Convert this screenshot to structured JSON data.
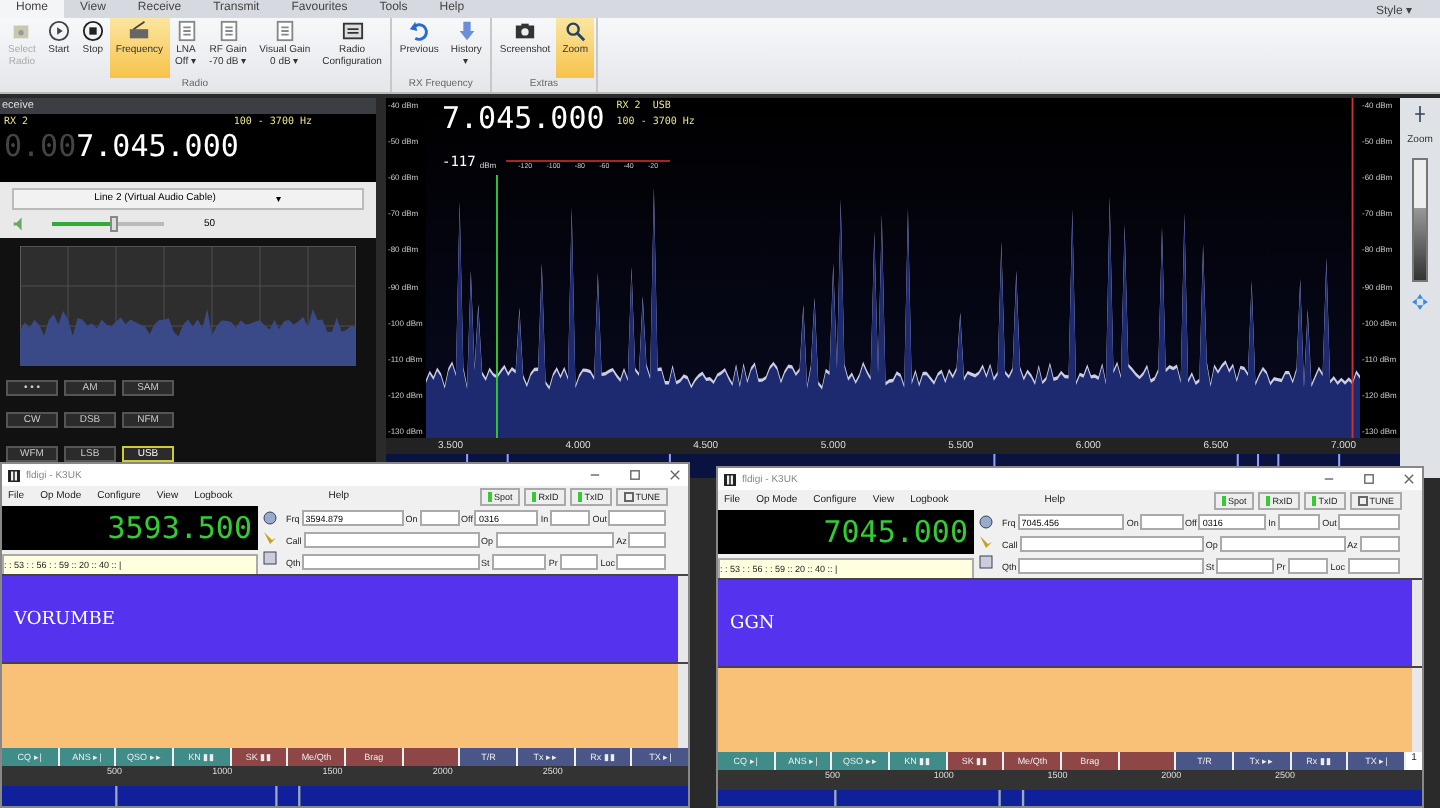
{
  "menu_tabs": [
    {
      "label": "Home",
      "selected": true
    },
    {
      "label": "View",
      "selected": false
    },
    {
      "label": "Receive",
      "selected": false
    },
    {
      "label": "Transmit",
      "selected": false
    },
    {
      "label": "Favourites",
      "selected": false
    },
    {
      "label": "Tools",
      "selected": false
    },
    {
      "label": "Help",
      "selected": false
    }
  ],
  "style_menu": "Style ▾",
  "ribbon_groups": [
    {
      "label": "Radio",
      "buttons": [
        {
          "kind": "select",
          "label": "Select",
          "sub": "Radio",
          "disabled": true,
          "selected": false
        },
        {
          "kind": "start",
          "label": "Start",
          "disabled": false,
          "selected": false
        },
        {
          "kind": "stop",
          "label": "Stop",
          "disabled": false,
          "selected": false
        },
        {
          "kind": "freq",
          "label": "Frequency",
          "disabled": false,
          "selected": true
        },
        {
          "kind": "list",
          "label": "LNA",
          "sub": "Off ▾",
          "disabled": false,
          "selected": false
        },
        {
          "kind": "list",
          "label": "RF Gain",
          "sub": "-70 dB ▾",
          "disabled": false,
          "selected": false
        },
        {
          "kind": "list",
          "label": "Visual Gain",
          "sub": "0 dB ▾",
          "disabled": false,
          "selected": false
        },
        {
          "kind": "config",
          "label": "Radio",
          "sub": "Configuration",
          "disabled": false,
          "selected": false
        }
      ]
    },
    {
      "label": "RX Frequency",
      "buttons": [
        {
          "kind": "undo",
          "label": "Previous",
          "disabled": false,
          "selected": false
        },
        {
          "kind": "history",
          "label": "History",
          "sub": "▾",
          "disabled": false,
          "selected": false
        }
      ]
    },
    {
      "label": "Extras",
      "buttons": [
        {
          "kind": "camera",
          "label": "Screenshot",
          "disabled": false,
          "selected": false
        },
        {
          "kind": "zoom",
          "label": "Zoom",
          "disabled": false,
          "selected": true
        }
      ]
    }
  ],
  "receive_panel": {
    "title": "eceive",
    "rx": "RX 2",
    "band": "100 - 3700 Hz",
    "freq_dim": "0.00",
    "freq": "7.045.000",
    "device": "Line 2 (Virtual Audio Cable)",
    "device_caret": "▾",
    "volume": {
      "level": 0.55,
      "reading": "50"
    },
    "modes": [
      {
        "label": "• • •",
        "selected": false
      },
      {
        "label": "AM",
        "selected": false
      },
      {
        "label": "SAM",
        "selected": false
      },
      {
        "label": "CW",
        "selected": false
      },
      {
        "label": "DSB",
        "selected": false
      },
      {
        "label": "NFM",
        "selected": false
      },
      {
        "label": "WFM",
        "selected": false
      },
      {
        "label": "LSB",
        "selected": false
      },
      {
        "label": "USB",
        "selected": true
      }
    ]
  },
  "spectrum": {
    "freq": "7.045.000",
    "rx": "RX 2",
    "mode": "USB",
    "band": "100 - 3700 Hz",
    "signal": "-117",
    "unit": "dBm",
    "meter_scale": [
      "-120",
      "-100",
      "-80",
      "-60",
      "-40",
      "-20"
    ],
    "y_labels": [
      "-40 dBm",
      "-50 dBm",
      "-60 dBm",
      "-70 dBm",
      "-80 dBm",
      "-90 dBm",
      "-100 dBm",
      "-110 dBm",
      "-120 dBm",
      "-130 dBm"
    ],
    "y_labels_right": [
      "-40 dBm",
      "-50 dBm",
      "-60 dBm",
      "-70 dBm",
      "-80 dBm",
      "-90 dBm",
      "-100 dBm",
      "-110 dBm",
      "-120 dBm",
      "-130 dBm"
    ],
    "x_labels": [
      "3.500",
      "4.000",
      "4.500",
      "5.000",
      "5.500",
      "6.000",
      "6.500",
      "7.000"
    ]
  },
  "side_strip": {
    "label": "Zoom",
    "level": 0.6
  },
  "fldigi_windows": [
    {
      "title": "fldigi - K3UK",
      "menu": [
        "File",
        "Op Mode",
        "Configure",
        "View",
        "Logbook",
        "Help"
      ],
      "indicators": [
        {
          "label": "Spot",
          "kind": "led",
          "on": true
        },
        {
          "label": "RxID",
          "kind": "led",
          "on": true
        },
        {
          "label": "TxID",
          "kind": "led",
          "on": true
        },
        {
          "label": "TUNE",
          "kind": "check",
          "checked": false
        }
      ],
      "freq": "3593.500",
      "time_strip": ": : 53 : : 56 : : 59 :: 20 :: 40 :: |",
      "fields": [
        {
          "label": "Frq",
          "value": "3594.879"
        },
        {
          "label": "On"
        },
        {
          "label": "Off",
          "value": "0316"
        },
        {
          "label": "In"
        },
        {
          "label": "Out"
        },
        {
          "label": "Call"
        },
        {
          "label": "Op"
        },
        {
          "label": "Az"
        },
        {
          "label": "Qth"
        },
        {
          "label": "St"
        },
        {
          "label": "Pr"
        },
        {
          "label": "Loc"
        }
      ],
      "rx_text": "VORUMBE",
      "macros": [
        {
          "label": "CQ ▸|",
          "color": "#3f8c88"
        },
        {
          "label": "ANS ▸|",
          "color": "#3f8c88"
        },
        {
          "label": "QSO ▸▸",
          "color": "#3f8c88"
        },
        {
          "label": "KN ▮▮",
          "color": "#3f8c88"
        },
        {
          "label": "SK ▮▮",
          "color": "#8e4646"
        },
        {
          "label": "Me/Qth",
          "color": "#8e4646"
        },
        {
          "label": "Brag",
          "color": "#8e4646"
        },
        {
          "color": "#8e4646"
        },
        {
          "label": "T/R",
          "color": "#4a5688"
        },
        {
          "label": "Tx ▸▸",
          "color": "#4a5688"
        },
        {
          "label": "Rx ▮▮",
          "color": "#4a5688"
        },
        {
          "label": "TX ▸|",
          "color": "#4a5688"
        }
      ],
      "scale": [
        "500",
        "1000",
        "1500",
        "2000",
        "2500"
      ]
    },
    {
      "title": "fldigi - K3UK",
      "menu": [
        "File",
        "Op Mode",
        "Configure",
        "View",
        "Logbook",
        "Help"
      ],
      "indicators": [
        {
          "label": "Spot",
          "kind": "led",
          "on": true
        },
        {
          "label": "RxID",
          "kind": "led",
          "on": true
        },
        {
          "label": "TxID",
          "kind": "led",
          "on": true
        },
        {
          "label": "TUNE",
          "kind": "check",
          "checked": false
        }
      ],
      "freq": "7045.000",
      "time_strip": ": : 53 : : 56 : : 59 :: 20 :: 40 :: |",
      "fields": [
        {
          "label": "Frq",
          "value": "7045.456"
        },
        {
          "label": "On"
        },
        {
          "label": "Off",
          "value": "0316"
        },
        {
          "label": "In"
        },
        {
          "label": "Out"
        },
        {
          "label": "Call"
        },
        {
          "label": "Op"
        },
        {
          "label": "Az"
        },
        {
          "label": "Qth"
        },
        {
          "label": "St"
        },
        {
          "label": "Pr"
        },
        {
          "label": "Loc"
        }
      ],
      "rx_text": "GGN",
      "macros": [
        {
          "label": "CQ ▸|",
          "color": "#3f8c88"
        },
        {
          "label": "ANS ▸|",
          "color": "#3f8c88"
        },
        {
          "label": "QSO ▸▸",
          "color": "#3f8c88"
        },
        {
          "label": "KN ▮▮",
          "color": "#3f8c88"
        },
        {
          "label": "SK ▮▮",
          "color": "#8e4646"
        },
        {
          "label": "Me/Qth",
          "color": "#8e4646"
        },
        {
          "label": "Brag",
          "color": "#8e4646"
        },
        {
          "color": "#8e4646"
        },
        {
          "label": "T/R",
          "color": "#4a5688"
        },
        {
          "label": "Tx ▸▸",
          "color": "#4a5688"
        },
        {
          "label": "Rx ▮▮",
          "color": "#4a5688"
        },
        {
          "label": "TX ▸|",
          "color": "#4a5688"
        }
      ],
      "macro_extra": "1",
      "scale": [
        "500",
        "1000",
        "1500",
        "2000",
        "2500"
      ]
    }
  ]
}
